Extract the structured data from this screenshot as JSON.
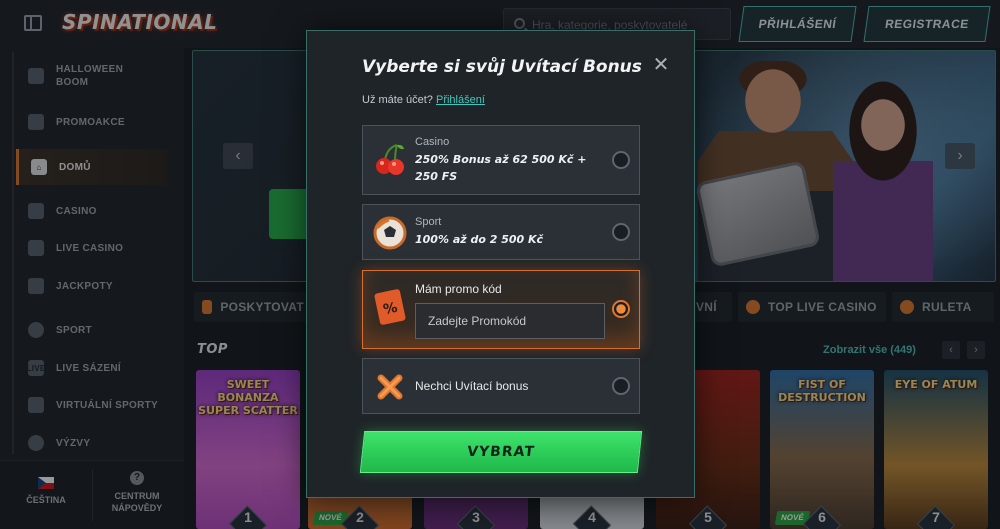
{
  "header": {
    "logo": "SPINATIONAL",
    "search_placeholder": "Hra, kategorie, poskytovatelé",
    "login_label": "PŘIHLÁŠENÍ",
    "register_label": "REGISTRACE"
  },
  "sidebar": {
    "items": [
      {
        "label": "HALLOWEEN BOOM",
        "icon": "pumpkin-icon"
      },
      {
        "label": "PROMOAKCE",
        "icon": "gift-icon"
      },
      {
        "label": "DOMŮ",
        "icon": "home-icon",
        "active": true
      },
      {
        "label": "CASINO",
        "icon": "slot-machine-icon"
      },
      {
        "label": "LIVE CASINO",
        "icon": "cards-icon"
      },
      {
        "label": "JACKPOTY",
        "icon": "clover-icon"
      },
      {
        "label": "SPORT",
        "icon": "soccer-ball-icon"
      },
      {
        "label": "LIVE SÁZENÍ",
        "icon": "live-icon"
      },
      {
        "label": "VIRTUÁLNÍ SPORTY",
        "icon": "monitor-icon"
      },
      {
        "label": "VÝZVY",
        "icon": "target-icon"
      }
    ],
    "language": "ČEŠTINA",
    "help_center": "CENTRUM NÁPOVĚDY"
  },
  "main": {
    "category_chips": [
      {
        "label": "POSKYTOVAT",
        "color": "#e0772e"
      },
      {
        "label": "VNÍ",
        "color": "#e0772e"
      },
      {
        "label": "TOP LIVE CASINO",
        "color": "#e0772e"
      },
      {
        "label": "RULETA",
        "color": "#e0772e"
      }
    ],
    "top_label": "TOP",
    "show_all": "Zobrazit vše (449)",
    "games": [
      {
        "rank": "1",
        "title": "SWEET BONANZA SUPER SCATTER",
        "new": false
      },
      {
        "rank": "2",
        "title": "",
        "new": true
      },
      {
        "rank": "3",
        "title": "",
        "new": false
      },
      {
        "rank": "4",
        "title": "",
        "new": false
      },
      {
        "rank": "5",
        "title": "",
        "new": false
      },
      {
        "rank": "6",
        "title": "FIST OF DESTRUCTION",
        "new": true
      },
      {
        "rank": "7",
        "title": "EYE OF ATUM",
        "new": false
      }
    ],
    "new_badge": "NOVÉ"
  },
  "modal": {
    "title": "Vyberte si svůj Uvítací Bonus",
    "account_prompt": "Už máte účet?",
    "account_link": "Přihlášení",
    "options": {
      "casino": {
        "label": "Casino",
        "desc": "250% Bonus až 62 500 Kč + 250 FS",
        "icon": "cherries-icon",
        "selected": false
      },
      "sport": {
        "label": "Sport",
        "desc": "100% až do 2 500 Kč",
        "icon": "soccer-ball-icon",
        "selected": false
      },
      "promo": {
        "label": "Mám promo kód",
        "placeholder": "Zadejte Promokód",
        "icon": "promo-ticket-icon",
        "selected": true
      },
      "none": {
        "label": "Nechci Uvítací bonus",
        "icon": "cross-icon",
        "selected": false
      }
    },
    "submit_label": "VYBRAT"
  },
  "colors": {
    "accent_teal": "#3ec9bd",
    "accent_orange": "#e0772e",
    "primary_green": "#2fd15c"
  }
}
